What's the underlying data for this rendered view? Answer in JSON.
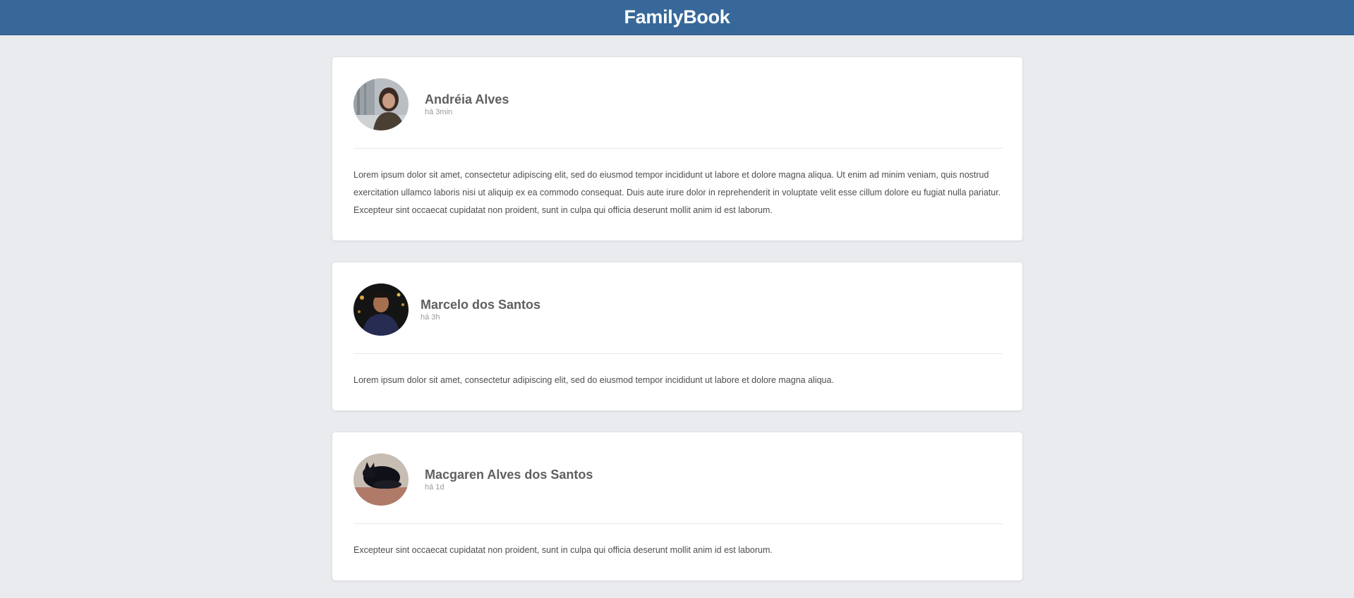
{
  "header": {
    "brand": "FamilyBook"
  },
  "posts": [
    {
      "author": "Andréia Alves",
      "time": "há 3min",
      "text": "Lorem ipsum dolor sit amet, consectetur adipiscing elit, sed do eiusmod tempor incididunt ut labore et dolore magna aliqua. Ut enim ad minim veniam, quis nostrud exercitation ullamco laboris nisi ut aliquip ex ea commodo consequat. Duis aute irure dolor in reprehenderit in voluptate velit esse cillum dolore eu fugiat nulla pariatur. Excepteur sint occaecat cupidatat non proident, sunt in culpa qui officia deserunt mollit anim id est laborum."
    },
    {
      "author": "Marcelo dos Santos",
      "time": "há 3h",
      "text": "Lorem ipsum dolor sit amet, consectetur adipiscing elit, sed do eiusmod tempor incididunt ut labore et dolore magna aliqua."
    },
    {
      "author": "Macgaren Alves dos Santos",
      "time": "há 1d",
      "text": "Excepteur sint occaecat cupidatat non proident, sunt in culpa qui officia deserunt mollit anim id est laborum."
    }
  ]
}
